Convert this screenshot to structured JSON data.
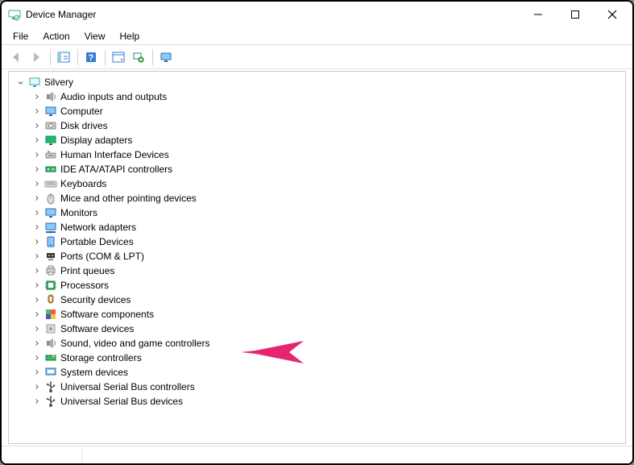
{
  "window": {
    "title": "Device Manager"
  },
  "menubar": {
    "items": [
      "File",
      "Action",
      "View",
      "Help"
    ]
  },
  "tree": {
    "root": {
      "label": "Silvery"
    },
    "categories": [
      {
        "label": "Audio inputs and outputs",
        "icon": "speaker"
      },
      {
        "label": "Computer",
        "icon": "computer"
      },
      {
        "label": "Disk drives",
        "icon": "disk"
      },
      {
        "label": "Display adapters",
        "icon": "display"
      },
      {
        "label": "Human Interface Devices",
        "icon": "hid"
      },
      {
        "label": "IDE ATA/ATAPI controllers",
        "icon": "ide"
      },
      {
        "label": "Keyboards",
        "icon": "keyboard"
      },
      {
        "label": "Mice and other pointing devices",
        "icon": "mouse"
      },
      {
        "label": "Monitors",
        "icon": "monitor"
      },
      {
        "label": "Network adapters",
        "icon": "network"
      },
      {
        "label": "Portable Devices",
        "icon": "portable"
      },
      {
        "label": "Ports (COM & LPT)",
        "icon": "ports"
      },
      {
        "label": "Print queues",
        "icon": "printer"
      },
      {
        "label": "Processors",
        "icon": "cpu"
      },
      {
        "label": "Security devices",
        "icon": "security"
      },
      {
        "label": "Software components",
        "icon": "softcomp"
      },
      {
        "label": "Software devices",
        "icon": "softdev"
      },
      {
        "label": "Sound, video and game controllers",
        "icon": "speaker"
      },
      {
        "label": "Storage controllers",
        "icon": "storage"
      },
      {
        "label": "System devices",
        "icon": "system"
      },
      {
        "label": "Universal Serial Bus controllers",
        "icon": "usb"
      },
      {
        "label": "Universal Serial Bus devices",
        "icon": "usb"
      }
    ]
  },
  "annotation": {
    "points_to_index": 17
  }
}
